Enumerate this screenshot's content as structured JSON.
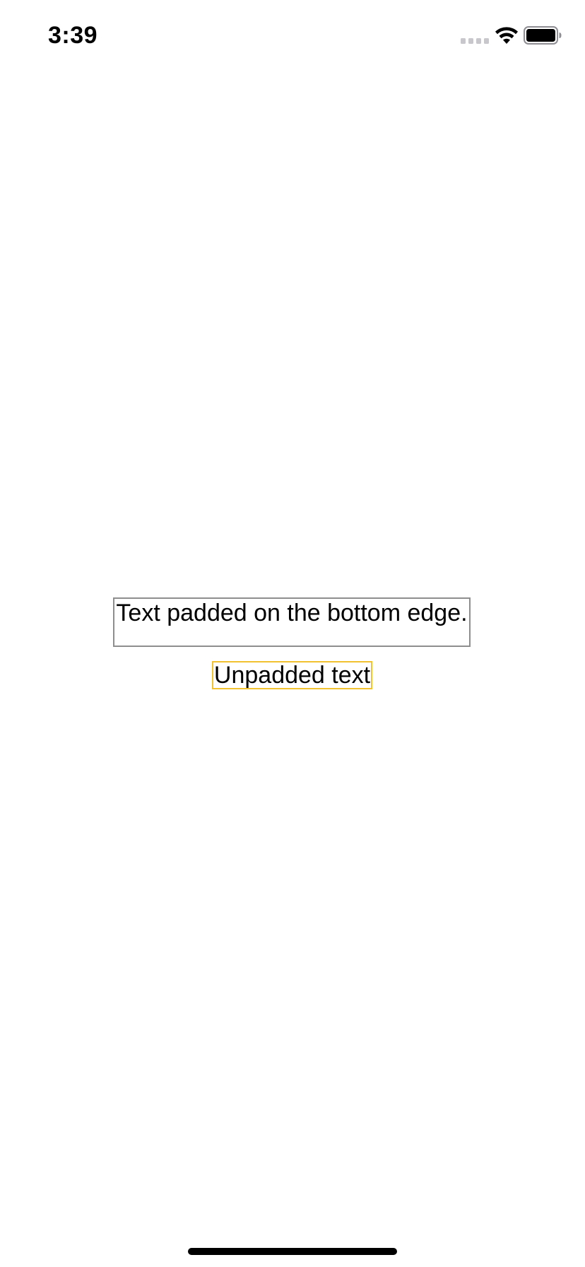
{
  "status_bar": {
    "time": "3:39",
    "icons": [
      "cellular-signal-icon",
      "wifi-icon",
      "battery-icon"
    ]
  },
  "content": {
    "padded_label": {
      "text": "Text padded on the bottom edge.",
      "border_color": "#8e8e8e"
    },
    "unpadded_label": {
      "text": "Unpadded text",
      "border_color": "#f2c230"
    }
  },
  "colors": {
    "background": "#ffffff",
    "text": "#000000"
  }
}
